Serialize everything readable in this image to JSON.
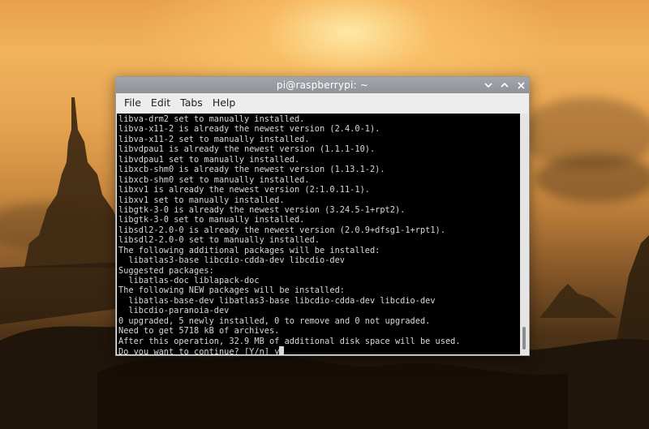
{
  "window": {
    "title": "pi@raspberrypi: ~"
  },
  "menu": {
    "items": [
      "File",
      "Edit",
      "Tabs",
      "Help"
    ]
  },
  "controls": {
    "minimize_icon": "chevron-down-icon",
    "maximize_icon": "chevron-up-icon",
    "close_icon": "close-icon"
  },
  "terminal": {
    "lines": [
      "libva-drm2 set to manually installed.",
      "libva-x11-2 is already the newest version (2.4.0-1).",
      "libva-x11-2 set to manually installed.",
      "libvdpau1 is already the newest version (1.1.1-10).",
      "libvdpau1 set to manually installed.",
      "libxcb-shm0 is already the newest version (1.13.1-2).",
      "libxcb-shm0 set to manually installed.",
      "libxv1 is already the newest version (2:1.0.11-1).",
      "libxv1 set to manually installed.",
      "libgtk-3-0 is already the newest version (3.24.5-1+rpt2).",
      "libgtk-3-0 set to manually installed.",
      "libsdl2-2.0-0 is already the newest version (2.0.9+dfsg1-1+rpt1).",
      "libsdl2-2.0-0 set to manually installed.",
      "The following additional packages will be installed:",
      "  libatlas3-base libcdio-cdda-dev libcdio-dev",
      "Suggested packages:",
      "  libatlas-doc liblapack-doc",
      "The following NEW packages will be installed:",
      "  libatlas-base-dev libatlas3-base libcdio-cdda-dev libcdio-dev",
      "  libcdio-paranoia-dev",
      "0 upgraded, 5 newly installed, 0 to remove and 0 not upgraded.",
      "Need to get 5718 kB of archives.",
      "After this operation, 32.9 MB of additional disk space will be used."
    ],
    "prompt": "Do you want to continue? [Y/n] ",
    "input": "y"
  },
  "colors": {
    "terminal_bg": "#000000",
    "terminal_fg": "#d8d8d8",
    "titlebar": "#979ba0"
  }
}
